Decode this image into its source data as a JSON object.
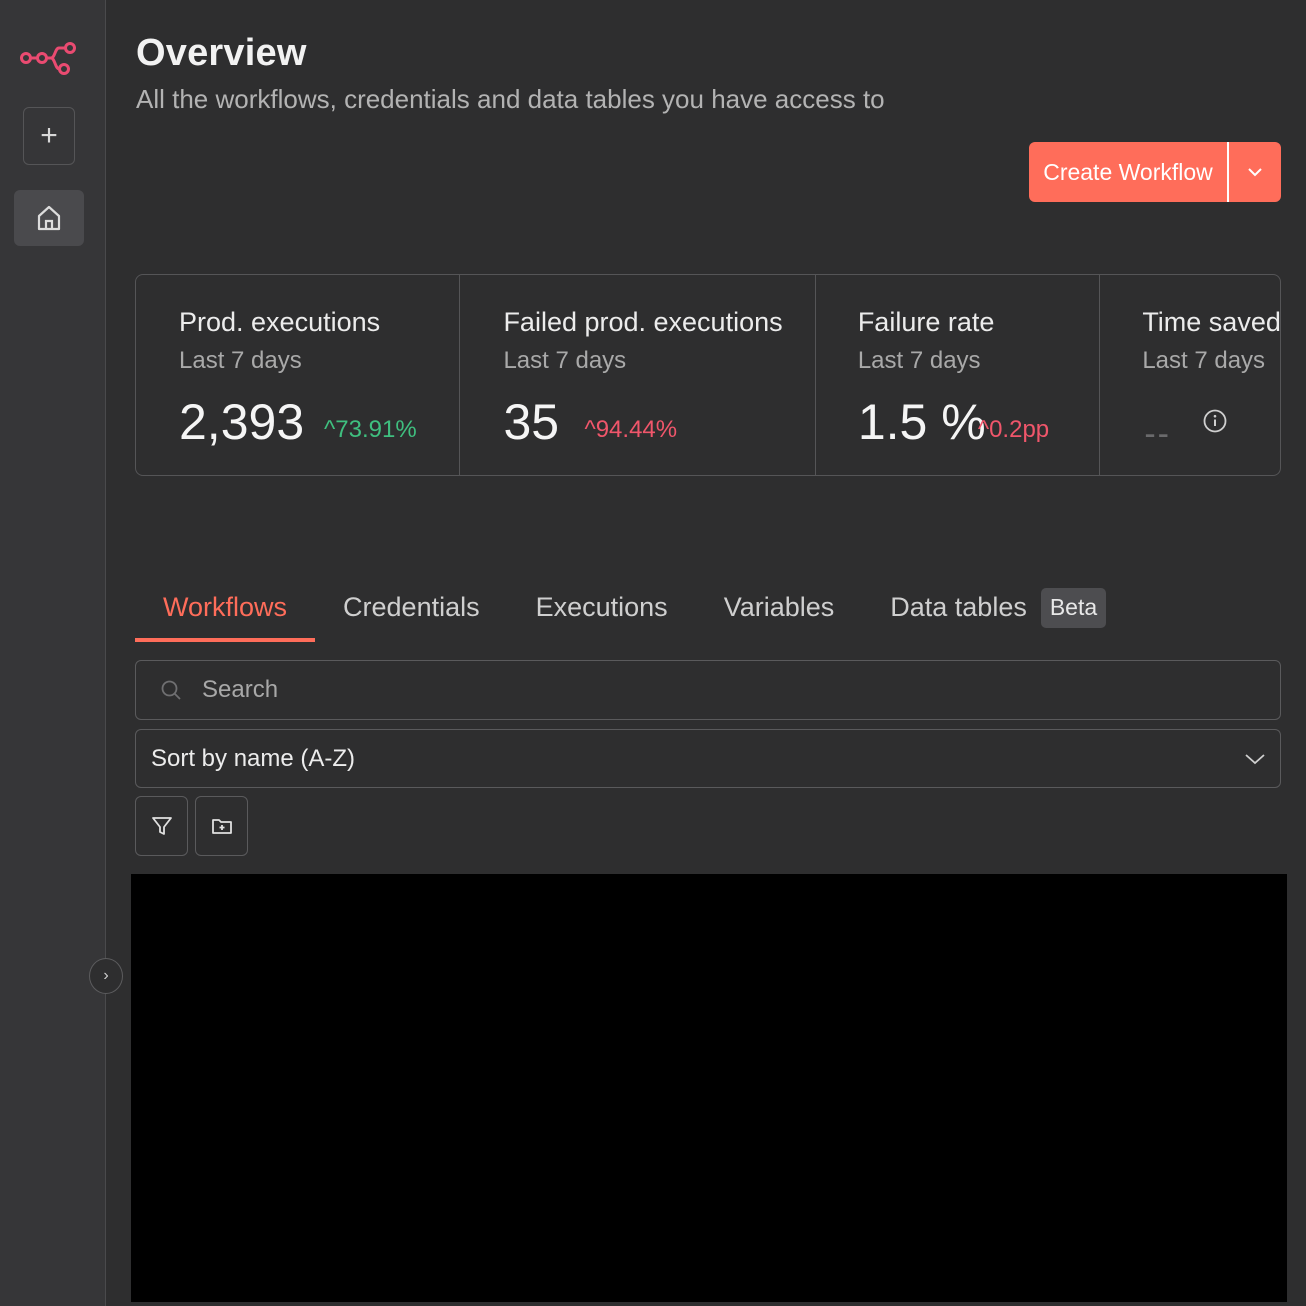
{
  "header": {
    "title": "Overview",
    "subtitle": "All the workflows, credentials and data tables you have access to",
    "create_label": "Create Workflow"
  },
  "stats": [
    {
      "label": "Prod. executions",
      "period": "Last 7 days",
      "value": "2,393",
      "delta": "^73.91%",
      "delta_color": "#3fbf7f"
    },
    {
      "label": "Failed prod. executions",
      "period": "Last 7 days",
      "value": "35",
      "delta": "^94.44%",
      "delta_color": "#f0566b"
    },
    {
      "label": "Failure rate",
      "period": "Last 7 days",
      "value": "1.5 %",
      "delta": "^0.2pp",
      "delta_color": "#f0566b"
    },
    {
      "label": "Time saved",
      "period": "Last 7 days",
      "value": "--",
      "icon": "info-icon"
    }
  ],
  "tabs": [
    {
      "label": "Workflows",
      "active": true
    },
    {
      "label": "Credentials"
    },
    {
      "label": "Executions"
    },
    {
      "label": "Variables"
    },
    {
      "label": "Data tables",
      "badge": "Beta"
    }
  ],
  "search": {
    "placeholder": "Search"
  },
  "sort": {
    "selected": "Sort by name (A-Z)"
  },
  "colors": {
    "accent": "#ff6d5a",
    "logo": "#ea4b71"
  }
}
